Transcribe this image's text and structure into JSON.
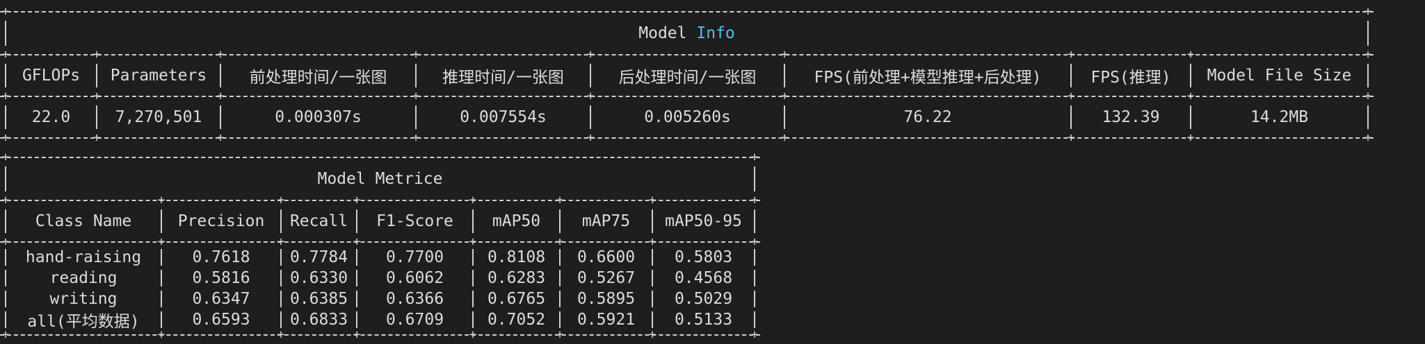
{
  "model_info": {
    "title_prefix": "Model",
    "title_accent": "Info",
    "headers": [
      "GFLOPs",
      "Parameters",
      "前处理时间/一张图",
      "推理时间/一张图",
      "后处理时间/一张图",
      "FPS(前处理+模型推理+后处理)",
      "FPS(推理)",
      "Model File Size"
    ],
    "values": [
      "22.0",
      "7,270,501",
      "0.000307s",
      "0.007554s",
      "0.005260s",
      "76.22",
      "132.39",
      "14.2MB"
    ]
  },
  "model_metrics": {
    "title": "Model Metrice",
    "headers": [
      "Class Name",
      "Precision",
      "Recall",
      "F1-Score",
      "mAP50",
      "mAP75",
      "mAP50-95"
    ],
    "rows": [
      [
        "hand-raising",
        "0.7618",
        "0.7784",
        "0.7700",
        "0.8108",
        "0.6600",
        "0.5803"
      ],
      [
        "reading",
        "0.5816",
        "0.6330",
        "0.6062",
        "0.6283",
        "0.5267",
        "0.4568"
      ],
      [
        "writing",
        "0.6347",
        "0.6385",
        "0.6366",
        "0.6765",
        "0.5895",
        "0.5029"
      ],
      [
        "all(平均数据)",
        "0.6593",
        "0.6833",
        "0.6709",
        "0.7052",
        "0.5921",
        "0.5133"
      ]
    ]
  },
  "colors": {
    "background": "#1e1e1e",
    "text": "#dcdcdc",
    "accent": "#4fc1e9"
  }
}
